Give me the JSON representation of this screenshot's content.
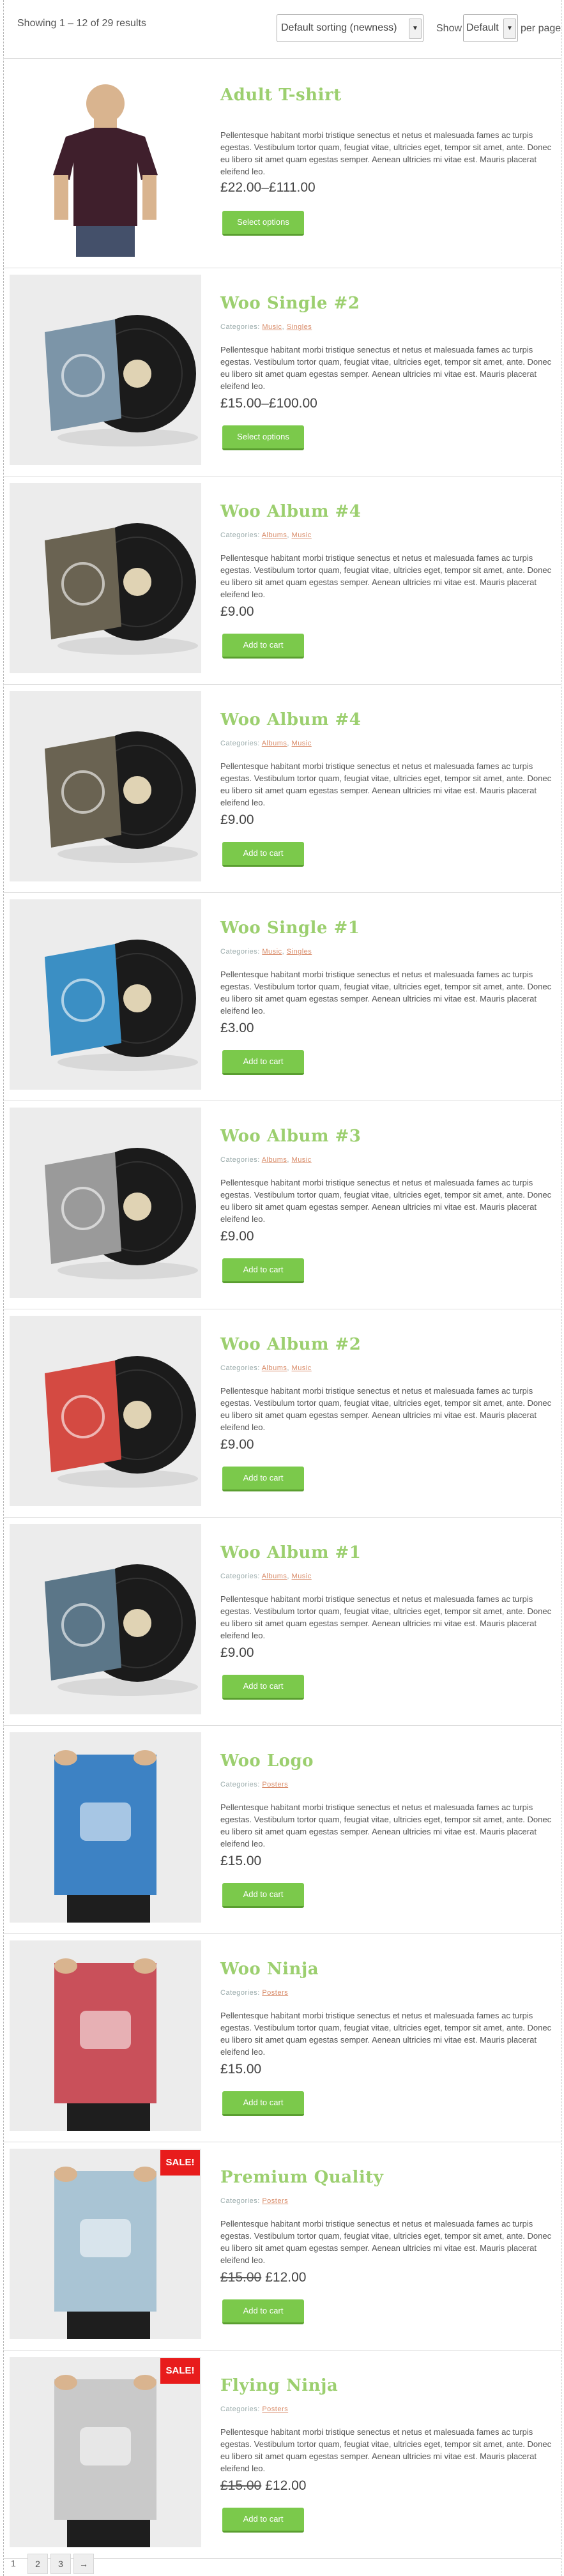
{
  "toolbar": {
    "result_count": "Showing 1 – 12 of 29 results",
    "sort_value": "Default sorting (newness)",
    "show_label": "Show",
    "show_value": "Default",
    "per_page_label": "per page"
  },
  "desc": "Pellentesque habitant morbi tristique senectus et netus et malesuada fames ac turpis egestas. Vestibulum tortor quam, feugiat vitae, ultricies eget, tempor sit amet, ante. Donec eu libero sit amet quam egestas semper. Aenean ultricies mi vitae est. Mauris placerat eleifend leo.",
  "categories_label": "Categories:",
  "products": [
    {
      "title": "Adult T-shirt",
      "categories": [],
      "price": "£22.00–£111.00",
      "old_price": "",
      "button": "Select options",
      "sale": ""
    },
    {
      "title": "Woo Single #2",
      "categories": [
        "Music",
        "Singles"
      ],
      "price": "£15.00–£100.00",
      "old_price": "",
      "button": "Select options",
      "sale": ""
    },
    {
      "title": "Woo Album #4",
      "categories": [
        "Albums",
        "Music"
      ],
      "price": "£9.00",
      "old_price": "",
      "button": "Add to cart",
      "sale": ""
    },
    {
      "title": "Woo Album #4",
      "categories": [
        "Albums",
        "Music"
      ],
      "price": "£9.00",
      "old_price": "",
      "button": "Add to cart",
      "sale": ""
    },
    {
      "title": "Woo Single #1",
      "categories": [
        "Music",
        "Singles"
      ],
      "price": "£3.00",
      "old_price": "",
      "button": "Add to cart",
      "sale": ""
    },
    {
      "title": "Woo Album #3",
      "categories": [
        "Albums",
        "Music"
      ],
      "price": "£9.00",
      "old_price": "",
      "button": "Add to cart",
      "sale": ""
    },
    {
      "title": "Woo Album #2",
      "categories": [
        "Albums",
        "Music"
      ],
      "price": "£9.00",
      "old_price": "",
      "button": "Add to cart",
      "sale": ""
    },
    {
      "title": "Woo Album #1",
      "categories": [
        "Albums",
        "Music"
      ],
      "price": "£9.00",
      "old_price": "",
      "button": "Add to cart",
      "sale": ""
    },
    {
      "title": "Woo Logo",
      "categories": [
        "Posters"
      ],
      "price": "£15.00",
      "old_price": "",
      "button": "Add to cart",
      "sale": ""
    },
    {
      "title": "Woo Ninja",
      "categories": [
        "Posters"
      ],
      "price": "£15.00",
      "old_price": "",
      "button": "Add to cart",
      "sale": ""
    },
    {
      "title": "Premium Quality",
      "categories": [
        "Posters"
      ],
      "price": "£12.00",
      "old_price": "£15.00",
      "button": "Add to cart",
      "sale": "SALE!"
    },
    {
      "title": "Flying Ninja",
      "categories": [
        "Posters"
      ],
      "price": "£12.00",
      "old_price": "£15.00",
      "button": "Add to cart",
      "sale": "SALE!"
    }
  ],
  "pagination": {
    "current": "1",
    "pages": [
      "2",
      "3"
    ],
    "next": "→"
  },
  "colors": {
    "title_green": "#9ccf6f",
    "button_green": "#7bc94b",
    "sale_red": "#e81c1c",
    "category_link": "#d88a67"
  }
}
